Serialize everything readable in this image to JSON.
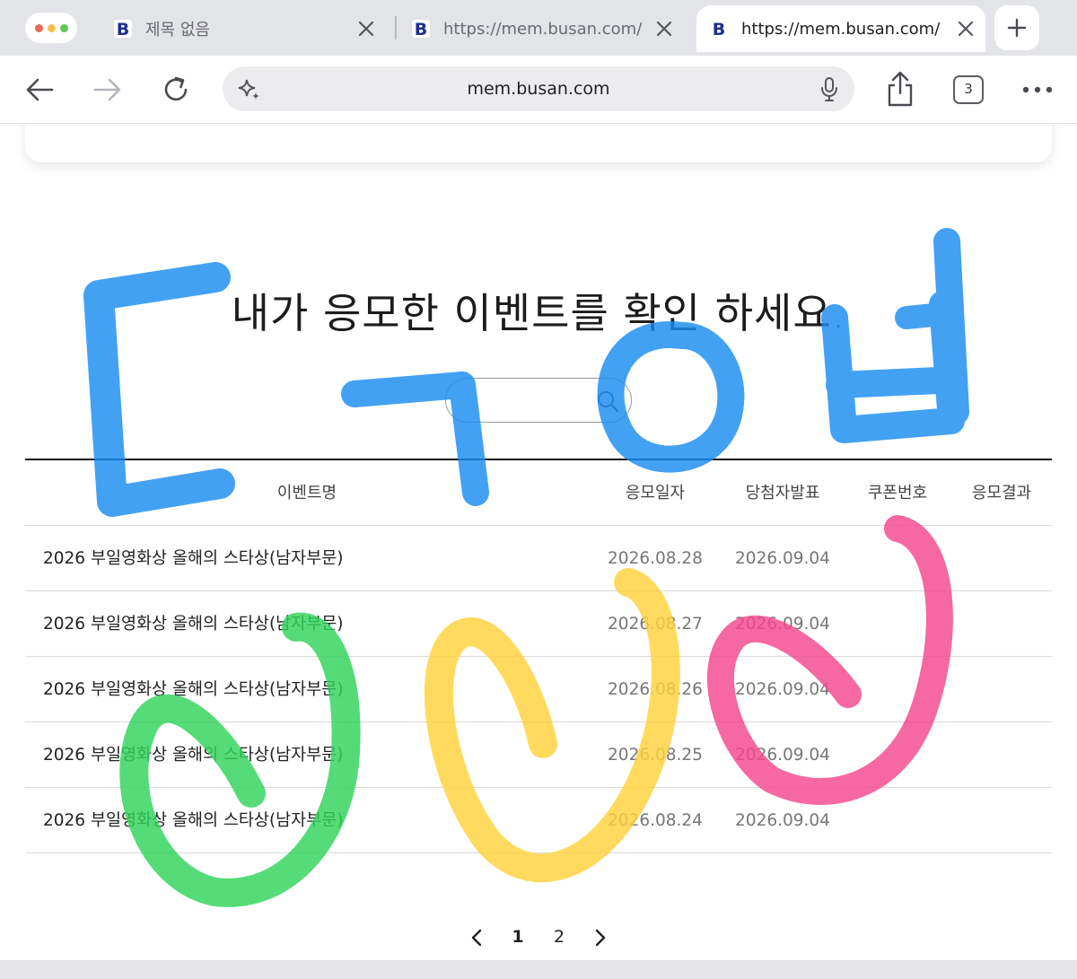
{
  "browser": {
    "tabs": [
      {
        "title": "제목 없음",
        "active": false
      },
      {
        "title": "https://mem.busan.com/",
        "active": false
      },
      {
        "title": "https://mem.busan.com/",
        "active": true
      }
    ],
    "favicon_letter": "B",
    "address": "mem.busan.com",
    "tab_count": "3"
  },
  "page": {
    "heading": "내가 응모한 이벤트를 확인 하세요.",
    "search": {
      "placeholder": ""
    },
    "table": {
      "headers": [
        "이벤트명",
        "응모일자",
        "당첨자발표",
        "쿠폰번호",
        "응모결과"
      ],
      "rows": [
        {
          "name": "2026 부일영화상 올해의 스타상(남자부문)",
          "applied": "2026.08.28",
          "announce": "2026.09.04",
          "coupon": "",
          "result": ""
        },
        {
          "name": "2026 부일영화상 올해의 스타상(남자부문)",
          "applied": "2026.08.27",
          "announce": "2026.09.04",
          "coupon": "",
          "result": ""
        },
        {
          "name": "2026 부일영화상 올해의 스타상(남자부문)",
          "applied": "2026.08.26",
          "announce": "2026.09.04",
          "coupon": "",
          "result": ""
        },
        {
          "name": "2026 부일영화상 올해의 스타상(남자부문)",
          "applied": "2026.08.25",
          "announce": "2026.09.04",
          "coupon": "",
          "result": ""
        },
        {
          "name": "2026 부일영화상 올해의 스타상(남자부문)",
          "applied": "2026.08.24",
          "announce": "2026.09.04",
          "coupon": "",
          "result": ""
        }
      ]
    },
    "pagination": {
      "pages": [
        "1",
        "2"
      ],
      "current": "1"
    }
  },
  "annotations": {
    "handwriting_text": "드디어",
    "colors": {
      "blue": "#1a8cf0",
      "green": "#2fd35a",
      "yellow": "#ffd23a",
      "pink": "#f4478c"
    }
  },
  "colors": {
    "tabbar": "#e3e4e8",
    "toolbar": "#ffffff",
    "address_bg": "#ececef",
    "rule": "#111111"
  }
}
